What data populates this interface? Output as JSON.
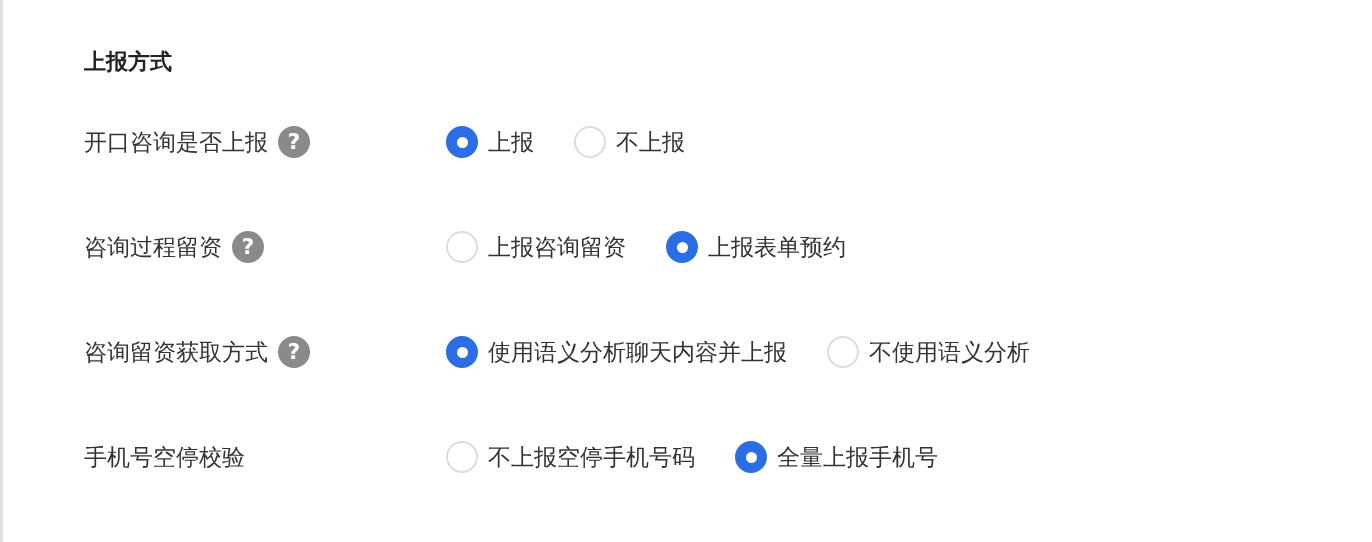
{
  "section_title": "上报方式",
  "rows": [
    {
      "label": "开口咨询是否上报",
      "help": "?",
      "options": [
        {
          "label": "上报",
          "selected": true
        },
        {
          "label": "不上报",
          "selected": false
        }
      ]
    },
    {
      "label": "咨询过程留资",
      "help": "?",
      "options": [
        {
          "label": "上报咨询留资",
          "selected": false
        },
        {
          "label": "上报表单预约",
          "selected": true
        }
      ]
    },
    {
      "label": "咨询留资获取方式",
      "help": "?",
      "options": [
        {
          "label": "使用语义分析聊天内容并上报",
          "selected": true
        },
        {
          "label": "不使用语义分析",
          "selected": false
        }
      ]
    },
    {
      "label": "手机号空停校验",
      "options": [
        {
          "label": "不上报空停手机号码",
          "selected": false
        },
        {
          "label": "全量上报手机号",
          "selected": true
        }
      ]
    }
  ]
}
